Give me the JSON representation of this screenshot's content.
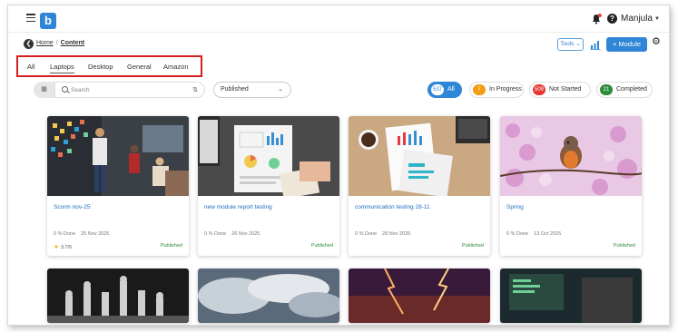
{
  "app": {
    "user_name": "Manjula",
    "logo_letter": "b"
  },
  "breadcrumb": {
    "home": "Home",
    "separator": "/",
    "current": "Content"
  },
  "toolbar": {
    "tools_label": "Tools",
    "module_label": "+ Module"
  },
  "tabs": [
    {
      "label": "All",
      "active": false
    },
    {
      "label": "Laptops",
      "active": true
    },
    {
      "label": "Desktop",
      "active": false
    },
    {
      "label": "General",
      "active": false
    },
    {
      "label": "Amazon",
      "active": false
    }
  ],
  "filters": {
    "search_placeholder": "Search",
    "status_selected": "Published",
    "pills": [
      {
        "count": "537",
        "label": "All",
        "color": "#2f86d6"
      },
      {
        "count": "7",
        "label": "In Progress",
        "color": "#f39c12"
      },
      {
        "count": "509",
        "label": "Not Started",
        "color": "#e53935"
      },
      {
        "count": "21",
        "label": "Completed",
        "color": "#2e8b3a"
      }
    ]
  },
  "cards": [
    {
      "title": "Scorm nov-25",
      "progress": "0 % Done",
      "date": "25 Nov 2025",
      "status": "Published",
      "rating": "3.7/5"
    },
    {
      "title": "new module report testing",
      "progress": "0 % Done",
      "date": "26 Nov 2025",
      "status": "Published"
    },
    {
      "title": "communication testing 28-11",
      "progress": "0 % Done",
      "date": "28 Nov 2025",
      "status": "Published"
    },
    {
      "title": "Spring",
      "progress": "0 % Done",
      "date": "13 Oct 2025",
      "status": "Published"
    }
  ],
  "icons": {
    "hamburger": "hamburger-icon",
    "bell": "bell-icon",
    "help": "help-icon",
    "back": "back-arrow-icon",
    "chart": "bar-chart-icon",
    "gear": "gear-icon",
    "search": "search-icon",
    "sort": "sort-icon",
    "grid": "grid-icon"
  }
}
